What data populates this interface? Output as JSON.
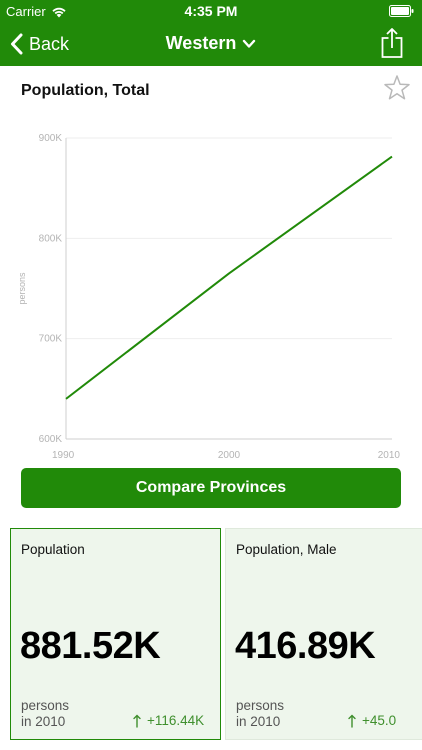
{
  "status_bar": {
    "carrier": "Carrier",
    "time": "4:35 PM"
  },
  "nav": {
    "back_label": "Back",
    "title": "Western",
    "icons": {
      "back": "chevron-left-icon",
      "title_dropdown": "chevron-down-icon",
      "share": "share-icon"
    }
  },
  "indicator": {
    "title": "Population, Total",
    "favorite_icon": "star-outline-icon"
  },
  "chart_data": {
    "type": "line",
    "title": "",
    "xlabel": "",
    "ylabel": "persons",
    "x": [
      1990,
      2000,
      2010
    ],
    "series": [
      {
        "values": [
          640000,
          765000,
          881520
        ]
      }
    ],
    "xlim": [
      1990,
      2010
    ],
    "ylim": [
      600000,
      900000
    ],
    "x_ticks": [
      "1990",
      "2000",
      "2010"
    ],
    "y_ticks": [
      {
        "value": 600000,
        "label": "600K"
      },
      {
        "value": 700000,
        "label": "700K"
      },
      {
        "value": 800000,
        "label": "800K"
      },
      {
        "value": 900000,
        "label": "900K"
      }
    ],
    "grid": true,
    "line_color": "#218a09"
  },
  "compare_button": {
    "label": "Compare Provinces"
  },
  "cards": [
    {
      "label": "Population",
      "value": "881.52K",
      "unit": "persons",
      "year_text": "in 2010",
      "change": "+116.44K",
      "change_icon": "up-arrow-icon",
      "selected": true
    },
    {
      "label": "Population, Male",
      "value": "416.89K",
      "unit": "persons",
      "year_text": "in 2010",
      "change": "+45.0",
      "change_icon": "up-arrow-icon",
      "selected": false
    }
  ],
  "colors": {
    "brand_green": "#218a09",
    "card_background": "#eef6ec",
    "change_green": "#3f8f2d"
  }
}
